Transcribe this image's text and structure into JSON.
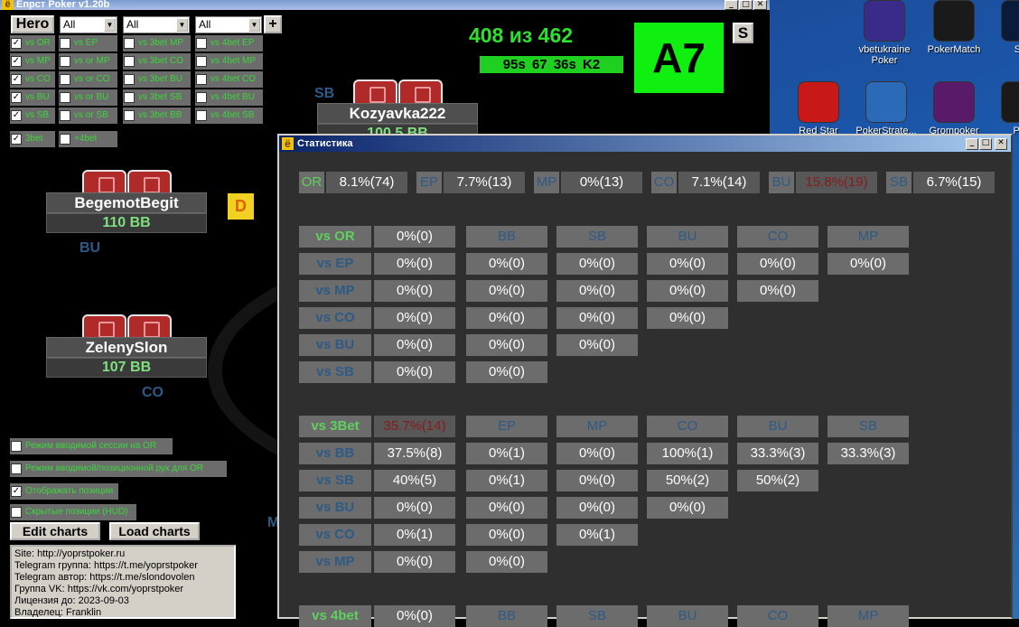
{
  "main_window": {
    "title": "Ёпрст Poker v1.20b",
    "hero_label": "Hero",
    "filters": [
      "All",
      "All",
      "All"
    ],
    "add_label": "+",
    "checkbox_grid": [
      [
        "vs OR",
        "vs EP",
        "vs 3bet MP",
        "vs 4bet EP"
      ],
      [
        "vs MP",
        "vs or MP",
        "vs 3bet CO",
        "vs 4bet MP"
      ],
      [
        "vs CO",
        "vs or CO",
        "vs 3bet BU",
        "vs 4bet CO"
      ],
      [
        "vs BU",
        "vs or BU",
        "vs 3bet SB",
        "vs 4bet BU"
      ],
      [
        "vs SB",
        "vs or SB",
        "vs 3bet BB",
        "vs 4bet SB"
      ]
    ],
    "checkbox_grid_checked": [
      true,
      true,
      true,
      true,
      true
    ],
    "extra_checks": [
      "3bet",
      "+4bet"
    ],
    "counter": "408 из 462",
    "timers": "95s  67  36s  K2",
    "hand": "A7",
    "s_button": "S",
    "dealer": "D",
    "players": [
      {
        "name": "Kozyavka222",
        "stack": "100.5 BB",
        "position": "SB"
      },
      {
        "name": "BegemotBegit",
        "stack": "110 BB",
        "position": "BU"
      },
      {
        "name": "ZelenySlon",
        "stack": "107 BB",
        "position": "CO"
      }
    ],
    "partial_position": "M",
    "options": [
      {
        "label": "Режим вводимой сессии на OR",
        "checked": false
      },
      {
        "label": "Режим вводимой/позиционной рук для OR",
        "checked": false
      },
      {
        "label": "Отображать позиции",
        "checked": true
      },
      {
        "label": "Скрытые позиции (HUD)",
        "checked": false
      }
    ],
    "edit_charts": "Edit charts",
    "load_charts": "Load charts",
    "info_lines": [
      "Site: http://yoprstpoker.ru",
      "Telegram группа: https://t.me/yoprstpoker",
      "Telegram автор: https://t.me/slondovolen",
      "Группа VK: https://vk.com/yoprstpoker",
      "Лицензия до: 2023-09-03",
      "Владелец: Franklin"
    ]
  },
  "desktop_icons": [
    {
      "label": "vbetukraine Poker",
      "color": "#3a2a8a"
    },
    {
      "label": "PokerMatch",
      "color": "#1a1a1a"
    },
    {
      "label": "Ste",
      "color": "#0a1a3a"
    },
    {
      "label": "Red Star",
      "color": "#c81818"
    },
    {
      "label": "PokerStrate...",
      "color": "#2a6ab8"
    },
    {
      "label": "Grompoker",
      "color": "#5a1a6a"
    },
    {
      "label": "Pok",
      "color": "#1a1a1a"
    }
  ],
  "stats_window": {
    "title": "Статистика",
    "top_stats": [
      {
        "label": "OR",
        "value": "8.1%(74)",
        "hi": false,
        "green": true
      },
      {
        "label": "EP",
        "value": "7.7%(13)",
        "hi": false
      },
      {
        "label": "MP",
        "value": "0%(13)",
        "hi": false
      },
      {
        "label": "CO",
        "value": "7.1%(14)",
        "hi": false
      },
      {
        "label": "BU",
        "value": "15.8%(19)",
        "hi": true
      },
      {
        "label": "SB",
        "value": "6.7%(15)",
        "hi": false
      }
    ],
    "vs_or": {
      "header": [
        "vs OR",
        "0%(0)",
        "BB",
        "SB",
        "BU",
        "CO",
        "MP"
      ],
      "rows": [
        [
          "vs EP",
          "0%(0)",
          "0%(0)",
          "0%(0)",
          "0%(0)",
          "0%(0)",
          "0%(0)"
        ],
        [
          "vs MP",
          "0%(0)",
          "0%(0)",
          "0%(0)",
          "0%(0)",
          "0%(0)"
        ],
        [
          "vs CO",
          "0%(0)",
          "0%(0)",
          "0%(0)",
          "0%(0)"
        ],
        [
          "vs BU",
          "0%(0)",
          "0%(0)",
          "0%(0)"
        ],
        [
          "vs SB",
          "0%(0)",
          "0%(0)"
        ]
      ]
    },
    "vs_3bet": {
      "header": [
        "vs 3Bet",
        "35.7%(14)",
        "EP",
        "MP",
        "CO",
        "BU",
        "SB"
      ],
      "rows": [
        [
          "vs BB",
          "37.5%(8)",
          "0%(1)",
          "0%(0)",
          "100%(1)",
          "33.3%(3)",
          "33.3%(3)"
        ],
        [
          "vs SB",
          "40%(5)",
          "0%(1)",
          "0%(0)",
          "50%(2)",
          "50%(2)"
        ],
        [
          "vs BU",
          "0%(0)",
          "0%(0)",
          "0%(0)",
          "0%(0)"
        ],
        [
          "vs CO",
          "0%(1)",
          "0%(0)",
          "0%(1)"
        ],
        [
          "vs MP",
          "0%(0)",
          "0%(0)"
        ]
      ]
    },
    "vs_4bet": {
      "header": [
        "vs 4bet",
        "0%(0)",
        "BB",
        "SB",
        "BU",
        "CO",
        "MP"
      ]
    }
  }
}
